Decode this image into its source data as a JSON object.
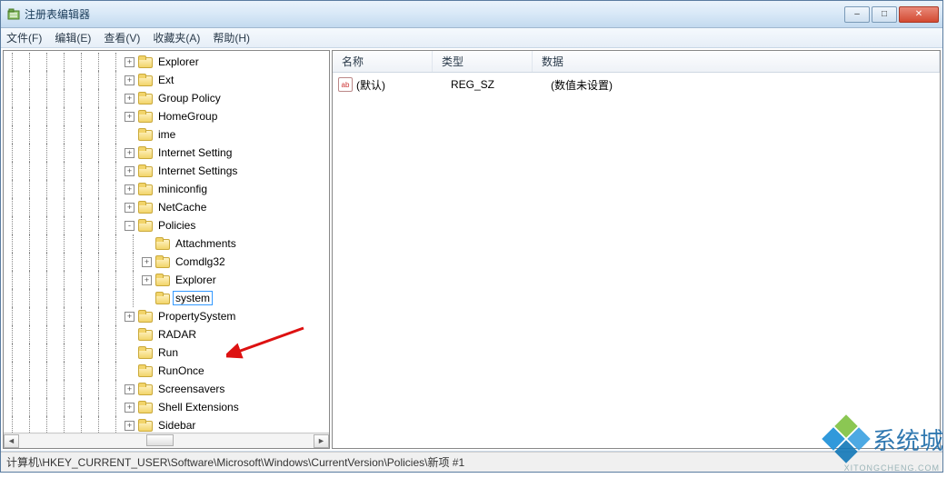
{
  "window": {
    "title": "注册表编辑器"
  },
  "menu": {
    "file": "文件(F)",
    "edit": "编辑(E)",
    "view": "查看(V)",
    "fav": "收藏夹(A)",
    "help": "帮助(H)"
  },
  "tree": [
    {
      "depth": 7,
      "toggle": "+",
      "label": "Explorer"
    },
    {
      "depth": 7,
      "toggle": "+",
      "label": "Ext"
    },
    {
      "depth": 7,
      "toggle": "+",
      "label": "Group Policy"
    },
    {
      "depth": 7,
      "toggle": "+",
      "label": "HomeGroup"
    },
    {
      "depth": 7,
      "toggle": "",
      "label": "ime"
    },
    {
      "depth": 7,
      "toggle": "+",
      "label": "Internet Setting"
    },
    {
      "depth": 7,
      "toggle": "+",
      "label": "Internet Settings"
    },
    {
      "depth": 7,
      "toggle": "+",
      "label": "miniconfig"
    },
    {
      "depth": 7,
      "toggle": "+",
      "label": "NetCache"
    },
    {
      "depth": 7,
      "toggle": "-",
      "label": "Policies"
    },
    {
      "depth": 8,
      "toggle": "",
      "label": "Attachments"
    },
    {
      "depth": 8,
      "toggle": "+",
      "label": "Comdlg32"
    },
    {
      "depth": 8,
      "toggle": "+",
      "label": "Explorer"
    },
    {
      "depth": 8,
      "toggle": "",
      "label": "system",
      "editing": true
    },
    {
      "depth": 7,
      "toggle": "+",
      "label": "PropertySystem"
    },
    {
      "depth": 7,
      "toggle": "",
      "label": "RADAR"
    },
    {
      "depth": 7,
      "toggle": "",
      "label": "Run"
    },
    {
      "depth": 7,
      "toggle": "",
      "label": "RunOnce"
    },
    {
      "depth": 7,
      "toggle": "+",
      "label": "Screensavers"
    },
    {
      "depth": 7,
      "toggle": "+",
      "label": "Shell Extensions"
    },
    {
      "depth": 7,
      "toggle": "+",
      "label": "Sidebar"
    }
  ],
  "columns": {
    "name": "名称",
    "type": "类型",
    "data": "数据"
  },
  "values": [
    {
      "icon": "ab",
      "name": "(默认)",
      "type": "REG_SZ",
      "data": "(数值未设置)"
    }
  ],
  "status": "计算机\\HKEY_CURRENT_USER\\Software\\Microsoft\\Windows\\CurrentVersion\\Policies\\新项 #1",
  "watermark": {
    "text": "系统城",
    "sub": "XITONGCHENG.COM"
  },
  "winbuttons": {
    "min": "–",
    "max": "□",
    "close": "✕"
  }
}
